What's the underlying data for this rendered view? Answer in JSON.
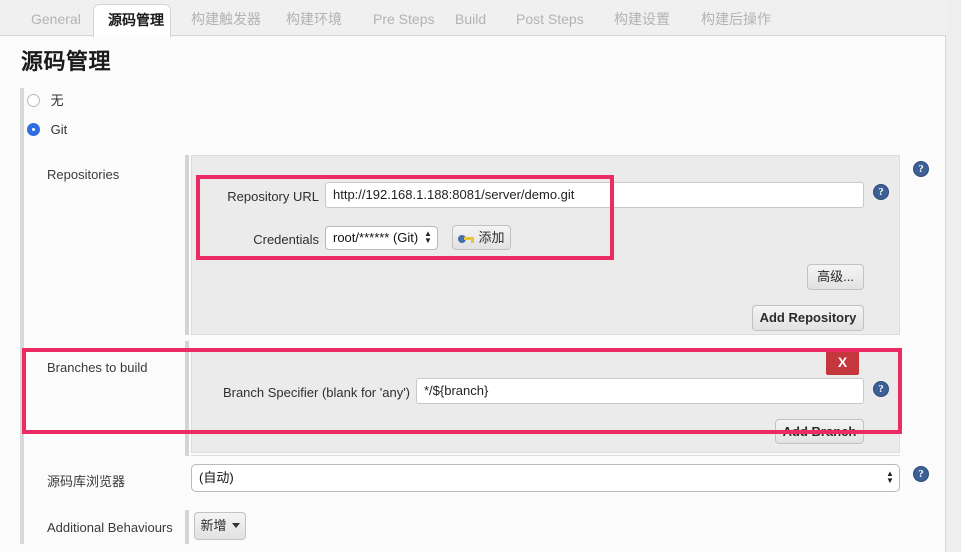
{
  "tabs": [
    {
      "label": "General",
      "active": false
    },
    {
      "label": "源码管理",
      "active": true
    },
    {
      "label": "构建触发器",
      "active": false
    },
    {
      "label": "构建环境",
      "active": false
    },
    {
      "label": "Pre Steps",
      "active": false
    },
    {
      "label": "Build",
      "active": false
    },
    {
      "label": "Post Steps",
      "active": false
    },
    {
      "label": "构建设置",
      "active": false
    },
    {
      "label": "构建后操作",
      "active": false
    }
  ],
  "page": {
    "heading": "源码管理"
  },
  "scm": {
    "options": [
      {
        "label": "无",
        "selected": false
      },
      {
        "label": "Git",
        "selected": true
      }
    ]
  },
  "repositories": {
    "section_label": "Repositories",
    "repository_url": {
      "label": "Repository URL",
      "value": "http://192.168.1.188:8081/server/demo.git"
    },
    "credentials": {
      "label": "Credentials",
      "value": "root/****** (Git)"
    },
    "add_credentials_button": "添加",
    "advanced_button": "高级...",
    "add_repository_button": "Add Repository"
  },
  "branches": {
    "section_label": "Branches to build",
    "branch_specifier": {
      "label": "Branch Specifier (blank for 'any')",
      "value": "*/${branch}"
    },
    "delete_button": "X",
    "add_branch_button": "Add Branch"
  },
  "repository_browser": {
    "label": "源码库浏览器",
    "value": "(自动)"
  },
  "additional_behaviours": {
    "label": "Additional Behaviours",
    "add_button": "新增"
  },
  "icons": {
    "help": "?"
  },
  "colors": {
    "annotation": "#ec2b62",
    "delete": "#c4383d",
    "radio_selected": "#2f6fe4",
    "help": "#3c5f96"
  }
}
